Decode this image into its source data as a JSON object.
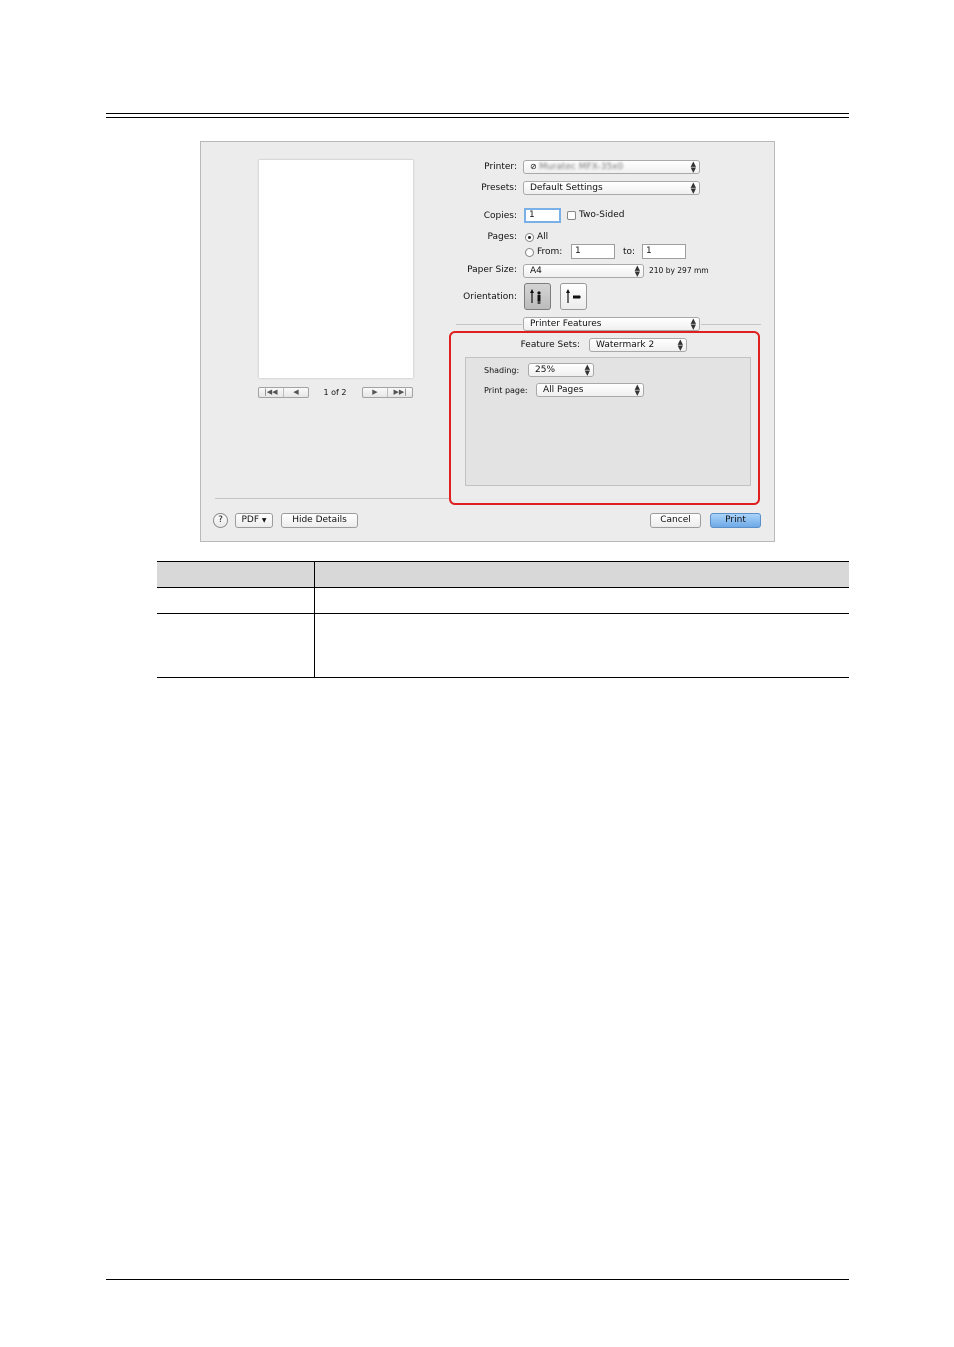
{
  "dialog": {
    "preview": {
      "page_indicator": "1 of 2"
    },
    "printer": {
      "label": "Printer:",
      "value": "Muratec MFX-35x0"
    },
    "presets": {
      "label": "Presets:",
      "value": "Default Settings"
    },
    "copies": {
      "label": "Copies:",
      "value": "1",
      "two_sided_label": "Two-Sided",
      "two_sided_checked": false
    },
    "pages": {
      "label": "Pages:",
      "all_label": "All",
      "all_selected": true,
      "from_label": "From:",
      "from_value": "1",
      "to_label": "to:",
      "to_value": "1"
    },
    "paper_size": {
      "label": "Paper Size:",
      "value": "A4",
      "dimensions": "210 by 297 mm"
    },
    "orientation": {
      "label": "Orientation:",
      "selected": "portrait"
    },
    "section_popup": {
      "value": "Printer Features"
    },
    "feature_sets": {
      "label": "Feature Sets:",
      "value": "Watermark 2"
    },
    "shading": {
      "label": "Shading:",
      "value": "25%"
    },
    "print_page": {
      "label": "Print page:",
      "value": "All Pages"
    },
    "footer": {
      "help": "?",
      "pdf": "PDF",
      "hide_details": "Hide Details",
      "cancel": "Cancel",
      "print": "Print"
    }
  },
  "colors": {
    "highlight_border": "#e02020",
    "default_button": "#7fb6ec"
  }
}
